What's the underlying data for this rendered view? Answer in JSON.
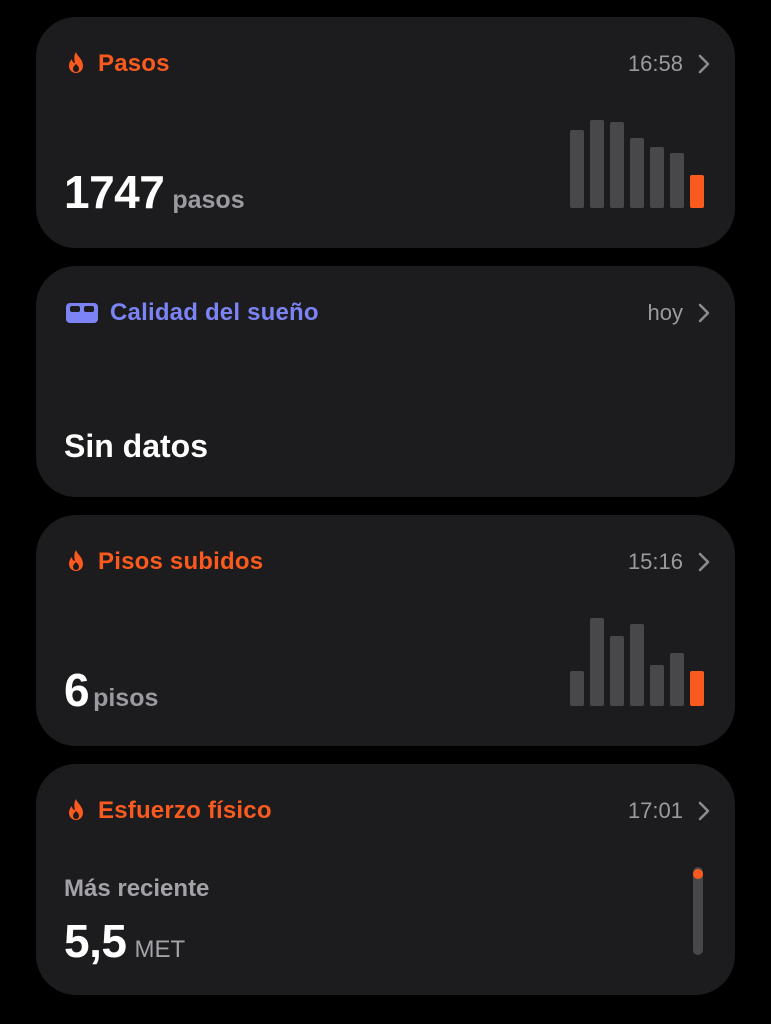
{
  "colors": {
    "orange": "#fa5a1e",
    "purple": "#7b83f5",
    "bar_gray": "#48484a"
  },
  "cards": {
    "steps": {
      "title": "Pasos",
      "icon": "flame-icon",
      "time": "16:58",
      "value": "1747",
      "unit": "pasos",
      "bars": [
        0.89,
        1.0,
        0.98,
        0.79,
        0.69,
        0.63,
        0.37
      ],
      "highlight_index": 6
    },
    "sleep": {
      "title": "Calidad del sueño",
      "icon": "bed-icon",
      "time": "hoy",
      "value": "Sin datos"
    },
    "floors": {
      "title": "Pisos subidos",
      "icon": "flame-icon",
      "time": "15:16",
      "value": "6",
      "unit": "pisos",
      "bars": [
        0.4,
        1.0,
        0.8,
        0.93,
        0.47,
        0.6,
        0.4
      ],
      "highlight_index": 6
    },
    "effort": {
      "title": "Esfuerzo físico",
      "icon": "flame-icon",
      "time": "17:01",
      "label": "Más reciente",
      "value": "5,5",
      "unit": "MET",
      "level": 0.97
    }
  }
}
